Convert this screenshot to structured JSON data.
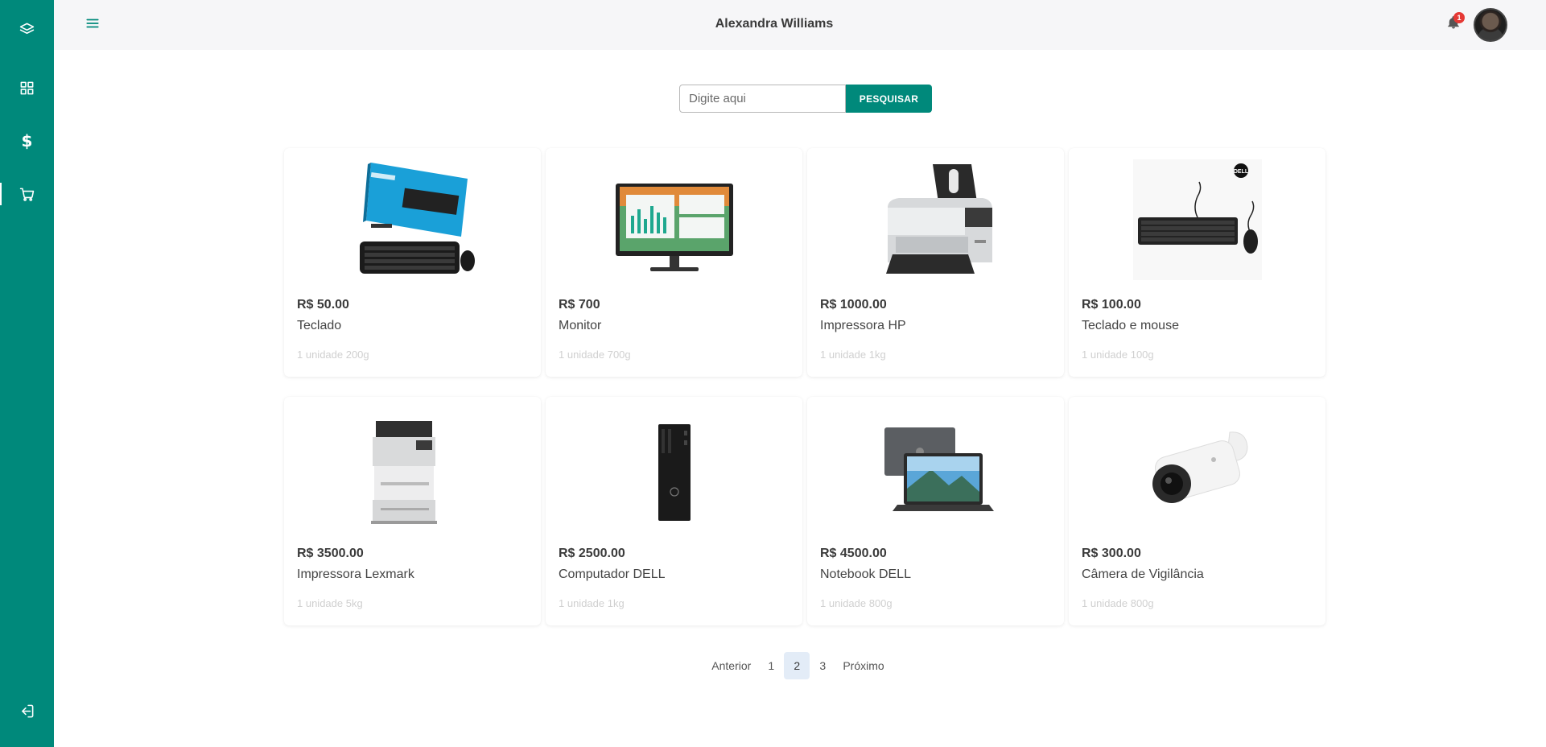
{
  "header": {
    "user_name": "Alexandra Williams",
    "notification_count": "1"
  },
  "sidebar": {
    "items": [
      {
        "name": "layers-icon"
      },
      {
        "name": "grid-icon"
      },
      {
        "name": "dollar-icon",
        "glyph": "$"
      },
      {
        "name": "cart-icon",
        "active": true
      },
      {
        "name": "logout-icon"
      }
    ]
  },
  "search": {
    "placeholder": "Digite aqui",
    "button_label": "PESQUISAR"
  },
  "products": [
    {
      "price": "R$ 50.00",
      "name": "Teclado",
      "unit": "1 unidade 200g",
      "image": "keyboard-mouse-box"
    },
    {
      "price": "R$ 700",
      "name": "Monitor",
      "unit": "1 unidade 700g",
      "image": "monitor"
    },
    {
      "price": "R$ 1000.00",
      "name": "Impressora HP",
      "unit": "1 unidade 1kg",
      "image": "printer"
    },
    {
      "price": "R$ 100.00",
      "name": "Teclado e mouse",
      "unit": "1 unidade 100g",
      "image": "keyboard-mouse"
    },
    {
      "price": "R$ 3500.00",
      "name": "Impressora Lexmark",
      "unit": "1 unidade 5kg",
      "image": "laser-printer"
    },
    {
      "price": "R$ 2500.00",
      "name": "Computador DELL",
      "unit": "1 unidade 1kg",
      "image": "desktop-tower"
    },
    {
      "price": "R$ 4500.00",
      "name": "Notebook DELL",
      "unit": "1 unidade 800g",
      "image": "laptop"
    },
    {
      "price": "R$ 300.00",
      "name": "Câmera de Vigilância",
      "unit": "1 unidade 800g",
      "image": "security-camera"
    }
  ],
  "pagination": {
    "previous": "Anterior",
    "pages": [
      "1",
      "2",
      "3"
    ],
    "current": "2",
    "next": "Próximo"
  },
  "colors": {
    "accent": "#00897b",
    "header_bg": "#f6f6f8",
    "active_page_bg": "#e3ecf7"
  }
}
